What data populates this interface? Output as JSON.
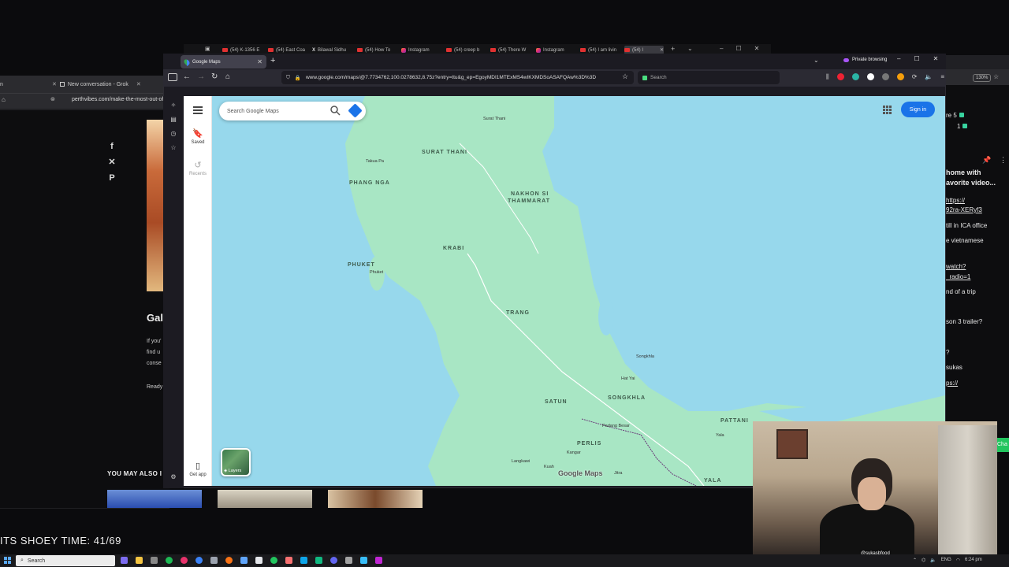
{
  "back_window": {
    "tabs": [
      {
        "label": "n"
      },
      {
        "label": "New conversation - Grok"
      }
    ],
    "url": "perthvibes.com/make-the-most-out-of",
    "heading": "Gall",
    "paragraph_lines": [
      "If you'",
      "find u",
      "conse"
    ],
    "ready_text": "Ready",
    "may_also": "YOU MAY ALSO I"
  },
  "back_strip_tabs": [
    {
      "label": "(54) K-1356 E",
      "kind": "yt"
    },
    {
      "label": "(54) East Coa",
      "kind": "yt"
    },
    {
      "label": "Bilawal Sidhu",
      "kind": "x"
    },
    {
      "label": "(54) How To",
      "kind": "yt"
    },
    {
      "label": "Instagram",
      "kind": "ig"
    },
    {
      "label": "(54) creep b",
      "kind": "yt"
    },
    {
      "label": "(54) There W",
      "kind": "yt"
    },
    {
      "label": "Instagram",
      "kind": "ig"
    },
    {
      "label": "(54) I am livin",
      "kind": "yt"
    },
    {
      "label": "(54) I",
      "kind": "yt"
    }
  ],
  "browser": {
    "active_tab": "Google Maps",
    "private_label": "Private browsing",
    "url": "www.google.com/maps/@7.7734762,100.0278632,8.75z?entry=ttu&g_ep=EgoyMDI1MTExMS4wIKXMDSoASAFQAw%3D%3D",
    "search_placeholder": "Search"
  },
  "maps": {
    "search_placeholder": "Search Google Maps",
    "saved_label": "Saved",
    "recents_label": "Recents",
    "get_app_label": "Get app",
    "layers_label": "Layers",
    "signin_label": "Sign in",
    "logo": "Google Maps",
    "labels": [
      {
        "text": "SURAT THANI"
      },
      {
        "text": "PHANG NGA"
      },
      {
        "text": "NAKHON SI"
      },
      {
        "text": "THAMMARAT"
      },
      {
        "text": "KRABI"
      },
      {
        "text": "PHUKET"
      },
      {
        "text": "TRANG"
      },
      {
        "text": "SATUN"
      },
      {
        "text": "SONGKHLA"
      },
      {
        "text": "PERLIS"
      },
      {
        "text": "PATTANI"
      },
      {
        "text": "YALA"
      }
    ],
    "places": [
      {
        "text": "Surat Thani"
      },
      {
        "text": "Takua Pa"
      },
      {
        "text": "Phuket"
      },
      {
        "text": "Songkhla"
      },
      {
        "text": "Hat Yai"
      },
      {
        "text": "Padang Besar"
      },
      {
        "text": "Kangar"
      },
      {
        "text": "Langkawi"
      },
      {
        "text": "Kuah"
      },
      {
        "text": "Jitra"
      },
      {
        "text": "Yala"
      }
    ]
  },
  "chat": {
    "lines": [
      {
        "text": "re 5"
      },
      {
        "text": "1"
      },
      {
        "text": "home with"
      },
      {
        "text": "avorite video..."
      },
      {
        "text": "https://"
      },
      {
        "text": "92ra-XERyf3"
      },
      {
        "text": "till in ICA office"
      },
      {
        "text": "e vietnamese"
      },
      {
        "text": "watch?"
      },
      {
        "text": "_radio=1"
      },
      {
        "text": "nd of a trip"
      },
      {
        "text": "son 3 trailer?"
      },
      {
        "text": "?"
      },
      {
        "text": "sukas"
      },
      {
        "text": "ps://"
      }
    ],
    "zoom": "130%",
    "tag": "Cha"
  },
  "overlay": {
    "shoey": "ITS SHOEY TIME: 41/69",
    "handle": "@sukasbfood"
  },
  "taskbar": {
    "search_label": "Search",
    "lang": "ENG",
    "time": "6:24 pm"
  }
}
